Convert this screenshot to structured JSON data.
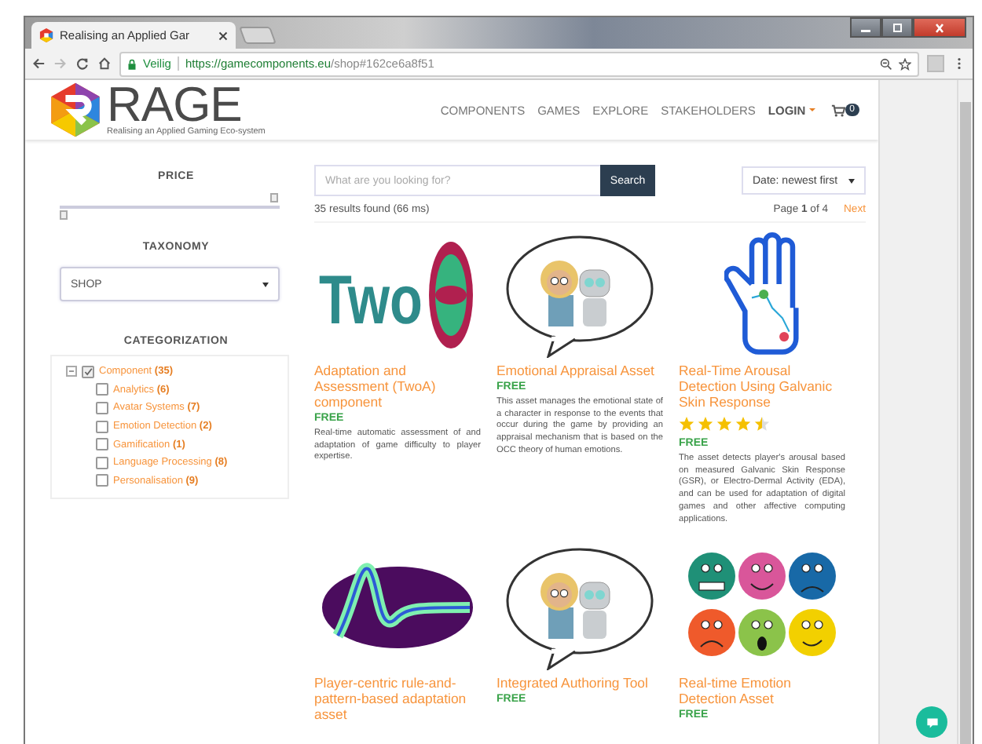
{
  "browser": {
    "tab_title": "Realising an Applied Gar",
    "secure_label": "Veilig",
    "url_host": "https://gamecomponents.eu",
    "url_path": "/shop#162ce6a8f51"
  },
  "site": {
    "logo": "RAGE",
    "tagline": "Realising an Applied Gaming Eco-system",
    "nav": [
      {
        "label": "COMPONENTS",
        "kind": "link"
      },
      {
        "label": "GAMES",
        "kind": "link"
      },
      {
        "label": "EXPLORE",
        "kind": "link"
      },
      {
        "label": "STAKEHOLDERS",
        "kind": "link"
      },
      {
        "label": "LOGIN",
        "kind": "dropdown"
      }
    ],
    "cart_count": "0"
  },
  "sidebar": {
    "price": {
      "title": "PRICE",
      "thumbs": [
        {
          "level": 0
        },
        {
          "level": 1
        }
      ]
    },
    "taxonomy": {
      "title": "TAXONOMY",
      "value": "SHOP"
    },
    "categorization": {
      "title": "CATEGORIZATION",
      "tree": [
        {
          "label": "Component",
          "count": "(35)",
          "checked": true,
          "expanded": true,
          "children": [
            {
              "label": "Analytics",
              "count": "(6)",
              "checked": false
            },
            {
              "label": "Avatar Systems",
              "count": "(7)",
              "checked": false
            },
            {
              "label": "Emotion Detection",
              "count": "(2)",
              "checked": false
            },
            {
              "label": "Gamification",
              "count": "(1)",
              "checked": false
            },
            {
              "label": "Language Processing",
              "count": "(8)",
              "checked": false
            },
            {
              "label": "Personalisation",
              "count": "(9)",
              "checked": false
            }
          ]
        }
      ]
    }
  },
  "search": {
    "placeholder": "What are you looking for?",
    "button": "Search",
    "sort": "Date: newest first",
    "results": "35 results found (66 ms)",
    "page": "Page **1** of 4",
    "next": "Next"
  },
  "cards": [
    {
      "kind": "twoa",
      "logo_text": "Two",
      "title": "Adaptation and Assessment (TwoA) component",
      "price": "FREE",
      "description": "Real-time automatic assessment of and adaptation of game difficulty to player expertise."
    },
    {
      "kind": "characters",
      "title": "Emotional Appraisal Asset",
      "price": "FREE",
      "description": "This asset manages the emotional state of a character in response to the events that occur during the game by providing an appraisal mechanism that is based on the OCC theory of human emotions."
    },
    {
      "kind": "hand",
      "title": "Real-Time Arousal Detection Using Galvanic Skin Response",
      "stars": 4.5,
      "price": "FREE",
      "description": "The asset detects player's arousal based on measured Galvanic Skin Response (GSR), or Electro-Dermal Activity (EDA), and can be used for adaptation of digital games and other affective computing applications."
    },
    {
      "kind": "wave",
      "title": "Player-centric rule-and-pattern-based adaptation asset"
    },
    {
      "kind": "characters",
      "title": "Integrated Authoring Tool",
      "price": "FREE"
    },
    {
      "kind": "faces",
      "title": "Real-time Emotion Detection Asset",
      "price": "FREE"
    }
  ]
}
